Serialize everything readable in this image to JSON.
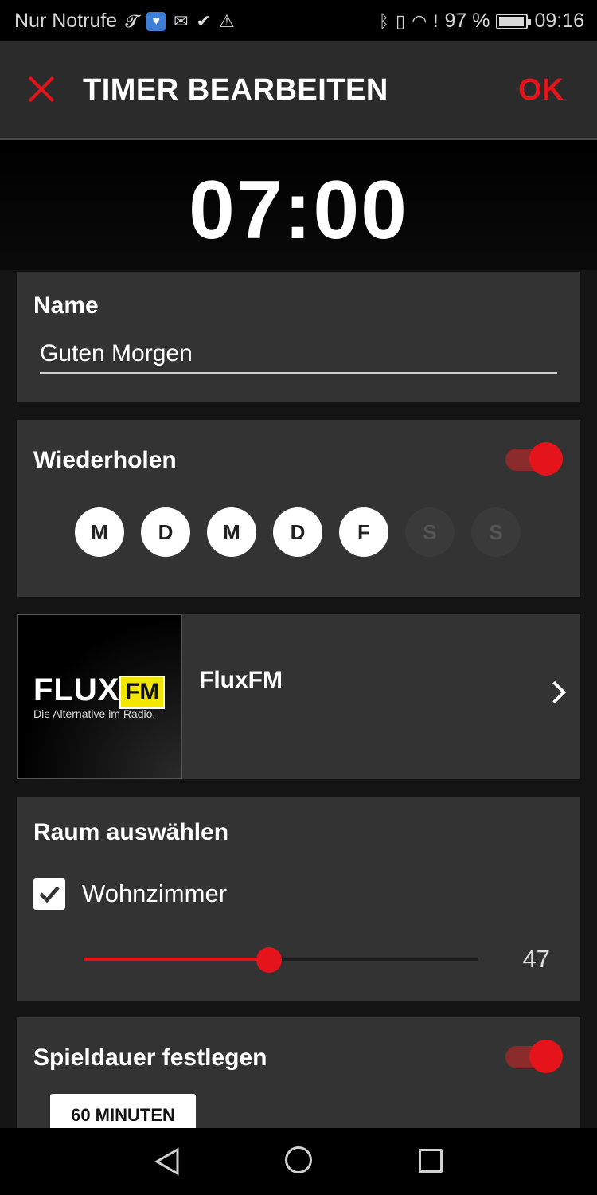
{
  "status_bar": {
    "carrier": "Nur Notrufe",
    "battery": "97 %",
    "time": "09:16",
    "icons_left": [
      "telekom-icon",
      "messenger-icon",
      "mail-icon",
      "checklist-icon",
      "warning-icon"
    ],
    "icons_right": [
      "bluetooth-icon",
      "vibrate-icon",
      "wifi-icon",
      "alert-icon",
      "battery-icon"
    ]
  },
  "appbar": {
    "title": "TIMER BEARBEITEN",
    "ok_label": "OK"
  },
  "timer": {
    "time": "07:00"
  },
  "name_card": {
    "label": "Name",
    "value": "Guten Morgen"
  },
  "repeat_card": {
    "label": "Wiederholen",
    "enabled": true,
    "days": [
      {
        "label": "M",
        "active": true
      },
      {
        "label": "D",
        "active": true
      },
      {
        "label": "M",
        "active": true
      },
      {
        "label": "D",
        "active": true
      },
      {
        "label": "F",
        "active": true
      },
      {
        "label": "S",
        "active": false
      },
      {
        "label": "S",
        "active": false
      }
    ]
  },
  "station_card": {
    "name": "FluxFM",
    "logo_wordmark": "FLUX",
    "logo_badge": "FM",
    "logo_slogan": "Die Alternative im Radio."
  },
  "room_card": {
    "label": "Raum auswählen",
    "room_name": "Wohnzimmer",
    "checked": true,
    "volume": 47,
    "volume_label": "47"
  },
  "duration_card": {
    "label": "Spieldauer festlegen",
    "enabled": true,
    "chip_label": "60 MINUTEN"
  },
  "colors": {
    "accent": "#e5131a",
    "card": "#333333",
    "appbar": "#2b2b2b",
    "flux_yellow": "#f2e600"
  }
}
